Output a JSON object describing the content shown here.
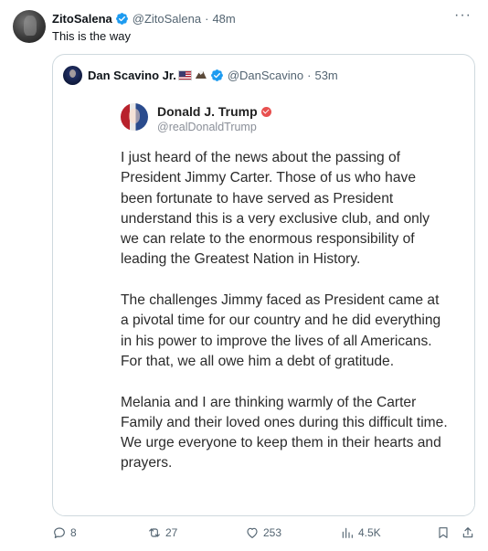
{
  "tweet": {
    "display_name": "ZitoSalena",
    "handle": "@ZitoSalena",
    "separator": "·",
    "time": "48m",
    "more_label": "···",
    "text": "This is the way"
  },
  "quoted": {
    "display_name": "Dan Scavino Jr.",
    "handle": "@DanScavino",
    "separator": "·",
    "time": "53m",
    "post": {
      "name": "Donald J. Trump",
      "handle": "@realDonaldTrump",
      "paragraphs": [
        "I just heard of the news about the passing of President Jimmy Carter. Those of us who have been fortunate to have served as President understand this is a very exclusive club, and only we can relate to the enormous responsibility of leading the Greatest Nation in History.",
        "The challenges Jimmy faced as President came at a pivotal time for our country and he did everything in his power to improve the lives of all Americans. For that, we all owe him a debt of gratitude.",
        "Melania and I are thinking warmly of the Carter Family and their loved ones during this difficult time. We urge everyone to keep them in their hearts and prayers."
      ]
    }
  },
  "actions": {
    "replies": "8",
    "reposts": "27",
    "likes": "253",
    "views": "4.5K"
  },
  "colors": {
    "verified": "#1d9bf0",
    "muted": "#536471",
    "border": "#cfd9de"
  }
}
